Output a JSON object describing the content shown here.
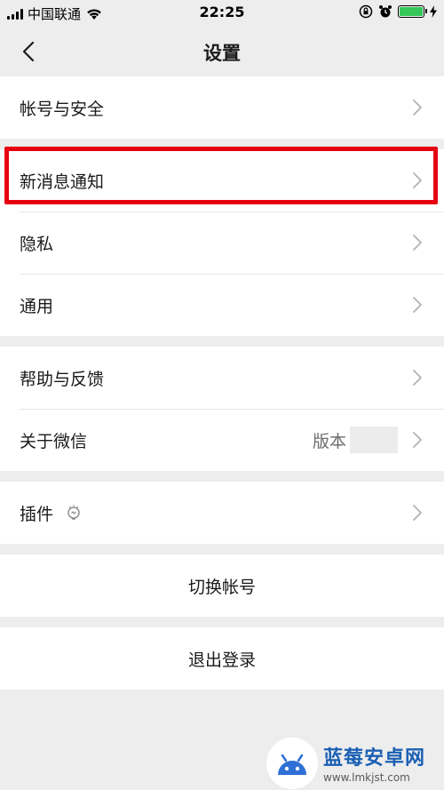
{
  "status_bar": {
    "carrier": "中国联通",
    "time": "22:25"
  },
  "nav": {
    "title": "设置"
  },
  "groups": [
    {
      "items": [
        {
          "label": "帐号与安全"
        }
      ]
    },
    {
      "items": [
        {
          "label": "新消息通知"
        },
        {
          "label": "隐私"
        },
        {
          "label": "通用"
        }
      ]
    },
    {
      "items": [
        {
          "label": "帮助与反馈"
        },
        {
          "label": "关于微信",
          "value": "版本"
        }
      ]
    },
    {
      "items": [
        {
          "label": "插件"
        }
      ]
    }
  ],
  "actions": {
    "switch_account": "切换帐号",
    "logout": "退出登录"
  },
  "watermark": {
    "name": "蓝莓安卓网",
    "url": "www.lmkjst.com"
  },
  "colors": {
    "highlight": "#e60012",
    "battery": "#35c759",
    "background": "#ededed",
    "watermark_blue": "#1a5fb4"
  },
  "icons": [
    "wifi-icon",
    "lock-rotation-icon",
    "alarm-icon",
    "battery-icon",
    "charging-icon",
    "back-chevron-icon",
    "chevron-right-icon",
    "plugin-bulb-icon",
    "android-robot-icon"
  ]
}
